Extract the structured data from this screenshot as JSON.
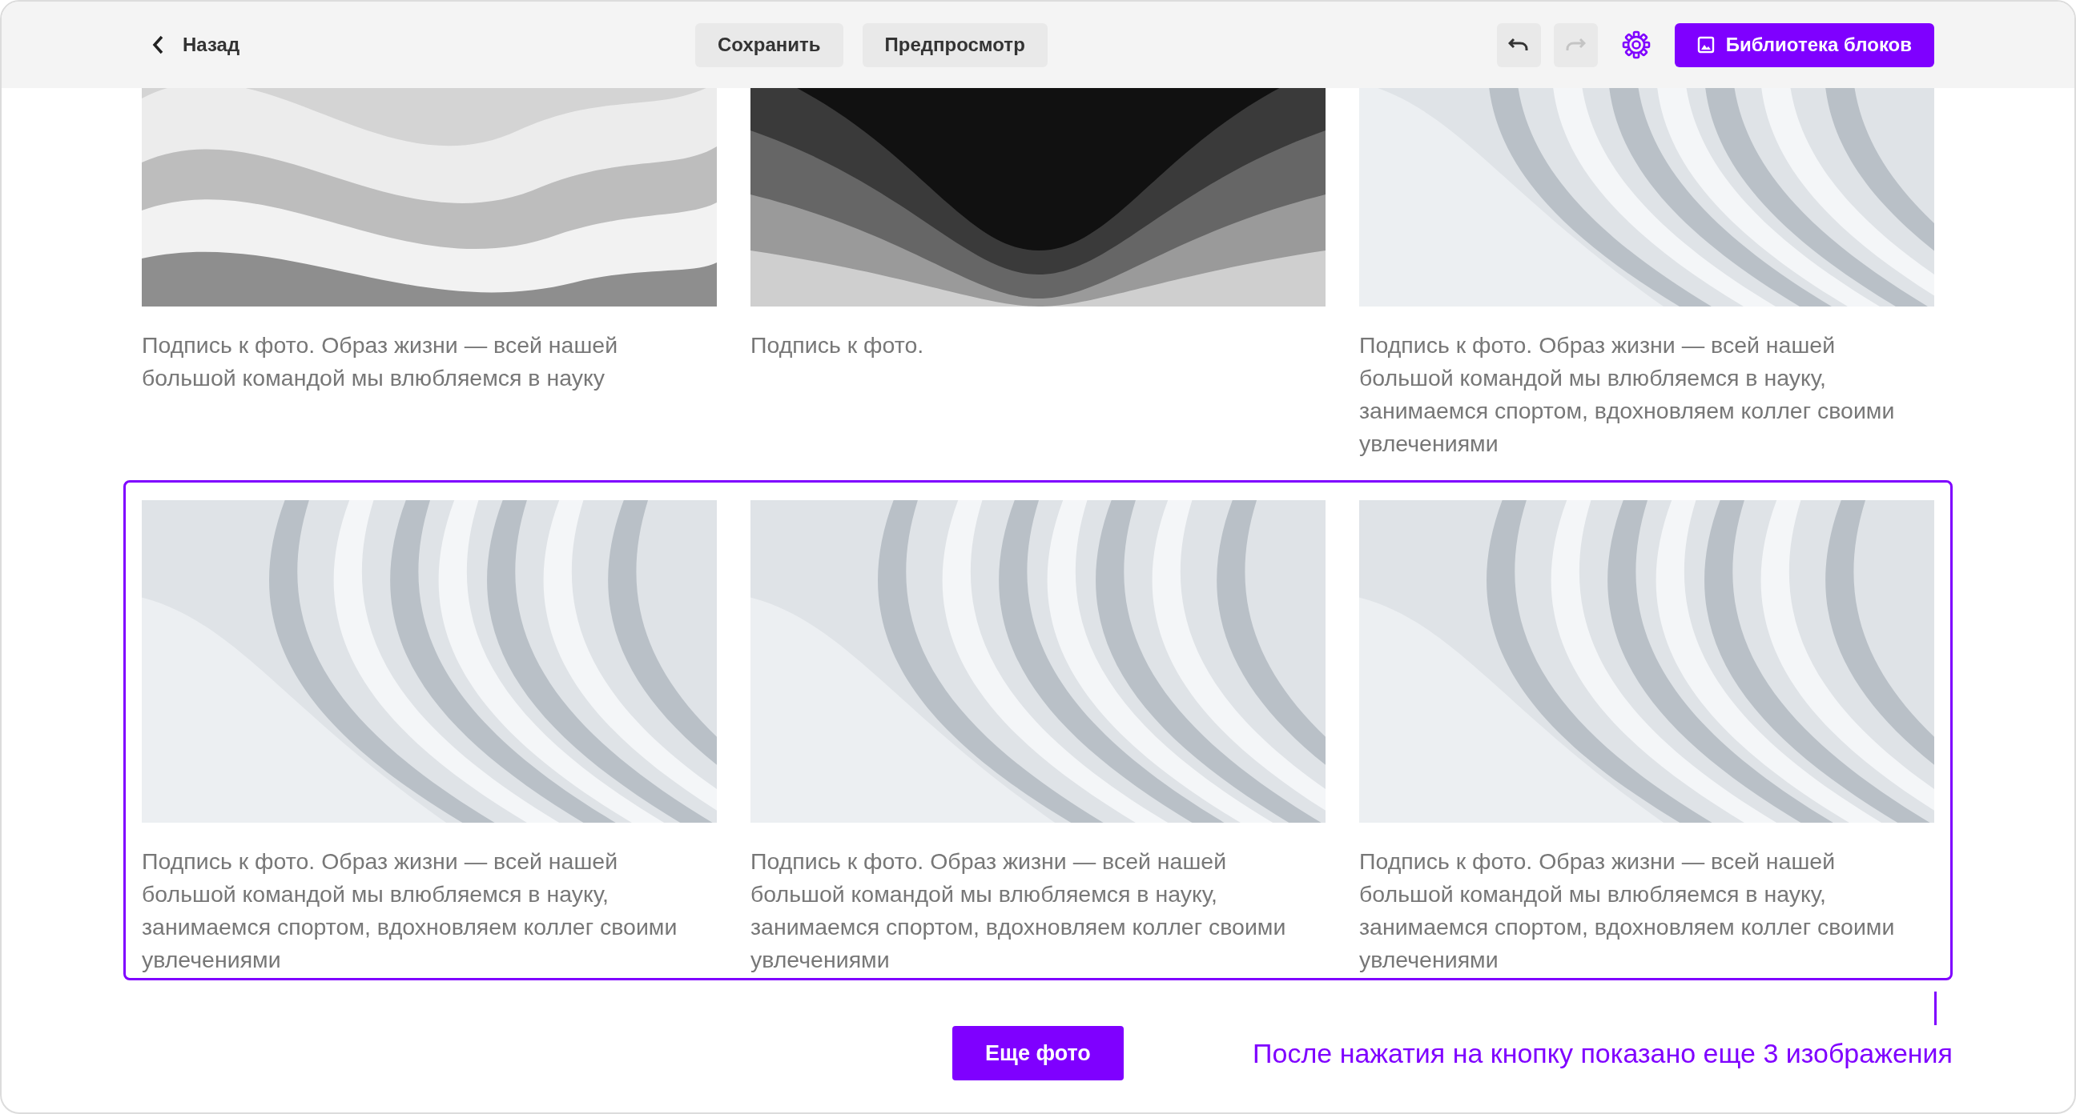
{
  "topbar": {
    "back": "Назад",
    "buttons": [
      {
        "label": "Сохранить"
      },
      {
        "label": "Предпросмотр"
      }
    ],
    "history": [
      {
        "kind": "undo",
        "disabled": false
      },
      {
        "kind": "redo",
        "disabled": true
      }
    ],
    "library_button": "Библиотека блоков"
  },
  "rows": [
    {
      "highlighted": false,
      "items": [
        {
          "kind": "picture",
          "caption": "Подпись к фото. Образ жизни — всей нашей большой командой мы влюбляемся в науку"
        },
        {
          "kind": "picture",
          "caption": "Подпись к фото."
        },
        {
          "kind": "picture",
          "caption": "Подпись к фото. Образ жизни — всей нашей большой командой мы влюбляемся в науку, занимаемся спортом, вдохновляем коллег своими увлечениями"
        }
      ]
    },
    {
      "highlighted": true,
      "items": [
        {
          "kind": "picture",
          "caption": "Подпись к фото. Образ жизни — всей нашей большой командой мы влюбляемся в науку, занимаемся спортом, вдохновляем коллег своими увлечениями"
        },
        {
          "kind": "picture",
          "caption": "Подпись к фото. Образ жизни — всей нашей большой командой мы влюбляемся в науку, занимаемся спортом, вдохновляем коллег своими увлечениями"
        },
        {
          "kind": "picture",
          "caption": "Подпись к фото. Образ жизни — всей нашей большой командой мы влюбляемся в науку, занимаемся спортом, вдохновляем коллег своими увлечениями"
        }
      ]
    }
  ],
  "more_button": "Еще фото",
  "annotation": "После нажатия на кнопку показано еще 3 изображения"
}
